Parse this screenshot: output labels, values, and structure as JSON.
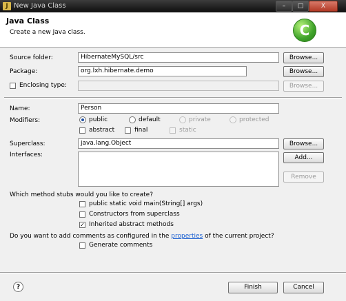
{
  "window": {
    "title": "New Java Class",
    "controls": {
      "minimize": "–",
      "maximize": "□",
      "close": "X"
    }
  },
  "banner": {
    "title": "Java Class",
    "description": "Create a new Java class.",
    "icon_letter": "C"
  },
  "form": {
    "source_folder": {
      "label": "Source folder:",
      "value": "HibernateMySQL/src",
      "button": "Browse..."
    },
    "package": {
      "label": "Package:",
      "value": "org.lxh.hibernate.demo",
      "button": "Browse..."
    },
    "enclosing_type": {
      "label": "Enclosing type:",
      "value": "",
      "button": "Browse...",
      "checked": false
    },
    "name": {
      "label": "Name:",
      "value": "Person"
    },
    "modifiers": {
      "label": "Modifiers:",
      "access": [
        {
          "label": "public",
          "selected": true,
          "enabled": true
        },
        {
          "label": "default",
          "selected": false,
          "enabled": true
        },
        {
          "label": "private",
          "selected": false,
          "enabled": false
        },
        {
          "label": "protected",
          "selected": false,
          "enabled": false
        }
      ],
      "flags": [
        {
          "label": "abstract",
          "checked": false,
          "enabled": true
        },
        {
          "label": "final",
          "checked": false,
          "enabled": true
        },
        {
          "label": "static",
          "checked": false,
          "enabled": false
        }
      ]
    },
    "superclass": {
      "label": "Superclass:",
      "value": "java.lang.Object",
      "button": "Browse..."
    },
    "interfaces": {
      "label": "Interfaces:",
      "add_button": "Add...",
      "remove_button": "Remove"
    },
    "stubs": {
      "question": "Which method stubs would you like to create?",
      "options": [
        {
          "label": "public static void main(String[] args)",
          "checked": false
        },
        {
          "label": "Constructors from superclass",
          "checked": false
        },
        {
          "label": "Inherited abstract methods",
          "checked": true
        }
      ]
    },
    "comments": {
      "question_prefix": "Do you want to add comments as configured in the ",
      "link": "properties",
      "question_suffix": " of the current project?",
      "option": {
        "label": "Generate comments",
        "checked": false
      }
    }
  },
  "footer": {
    "help": "?",
    "finish": "Finish",
    "cancel": "Cancel"
  }
}
